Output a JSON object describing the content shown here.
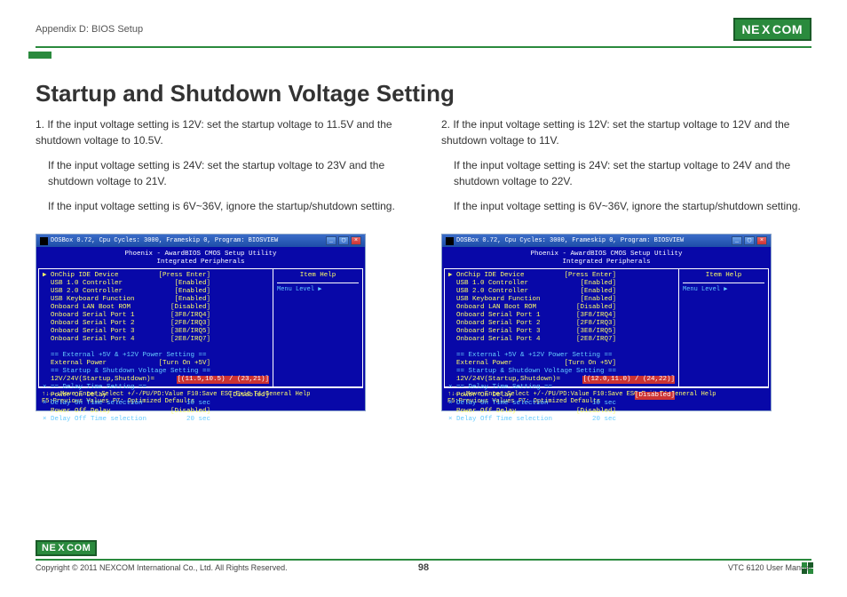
{
  "header": {
    "section": "Appendix D: BIOS Setup",
    "logo": {
      "left": "NE",
      "x": "X",
      "right": "COM"
    }
  },
  "title": "Startup and Shutdown Voltage Setting",
  "left_col": {
    "p1": "1. If the input voltage setting is 12V: set the startup voltage to 11.5V and the shutdown voltage to 10.5V.",
    "p2": "If the input voltage setting is 24V: set the startup voltage to 23V and the shutdown voltage to 21V.",
    "p3": "If the input voltage setting is 6V~36V, ignore the startup/shutdown setting."
  },
  "right_col": {
    "p1": "2. If the input voltage setting is 12V: set the startup voltage to 12V and the shutdown voltage to 11V.",
    "p2": "If the input voltage setting is 24V: set the startup voltage to 24V and the shutdown voltage to 22V.",
    "p3": "If the input voltage setting is 6V~36V, ignore the startup/shutdown setting."
  },
  "bios_common": {
    "titlebar": "DOSBox 0.72, Cpu Cycles:   3000, Frameskip  0, Program: BIOSVIEW",
    "header1": "Phoenix - AwardBIOS CMOS Setup Utility",
    "header2": "Integrated Peripherals",
    "help_title": "Item Help",
    "menu_level": "Menu Level  ▶",
    "rows": [
      {
        "label": "▶ OnChip IDE Device",
        "val": "[Press Enter]",
        "cls": ""
      },
      {
        "label": "  USB 1.0 Controller",
        "val": "[Enabled]",
        "cls": ""
      },
      {
        "label": "  USB 2.0 Controller",
        "val": "[Enabled]",
        "cls": ""
      },
      {
        "label": "  USB Keyboard Function",
        "val": "[Enabled]",
        "cls": ""
      },
      {
        "label": "  Onboard LAN Boot ROM",
        "val": "[Disabled]",
        "cls": ""
      },
      {
        "label": "  Onboard Serial Port 1",
        "val": "[3F8/IRQ4]",
        "cls": ""
      },
      {
        "label": "  Onboard Serial Port 2",
        "val": "[2F8/IRQ3]",
        "cls": ""
      },
      {
        "label": "  Onboard Serial Port 3",
        "val": "[3E8/IRQ5]",
        "cls": ""
      },
      {
        "label": "  Onboard Serial Port 4",
        "val": "[2E8/IRQ7]",
        "cls": ""
      }
    ],
    "ext_heading": "  == External +5V & +12V Power Setting ==",
    "ext_power_label": "  External Power",
    "ext_power_val": "[Turn On +5V]",
    "startup_heading": "  == Startup & Shutdown Voltage Setting ==",
    "delay_heading": "× == Delay Time Setting ==",
    "power_on_label": "  Power On Delay",
    "power_on_val_l": "[Disabled]",
    "power_on_val_r": "[Disabled]",
    "delay_on_label": "× Delay On Time selection",
    "delay_on_val": "  10 sec",
    "power_off_label": "  Power Off Delay",
    "power_off_val": "[Disabled]",
    "delay_off_label": "× Delay Off Time selection",
    "delay_off_val": "  20 sec",
    "footer1": "↑↓→←:Move  Enter:Select  +/-/PU/PD:Value  F10:Save  ESC:Exit  F1:General Help",
    "footer2": "           F5:Previous Values            F7: Optimized Defaults"
  },
  "bios_left": {
    "startup_label": "  12V/24V(Startup,Shutdown)=",
    "startup_val": "[(11.5,10.5) / (23,21)]"
  },
  "bios_right": {
    "startup_label": "  12V/24V(Startup,Shutdown)=",
    "startup_val": "[(12.0,11.0) / (24,22)]"
  },
  "footer": {
    "copyright": "Copyright © 2011 NEXCOM International Co., Ltd. All Rights Reserved.",
    "page": "98",
    "manual": "VTC 6120 User Manual"
  }
}
